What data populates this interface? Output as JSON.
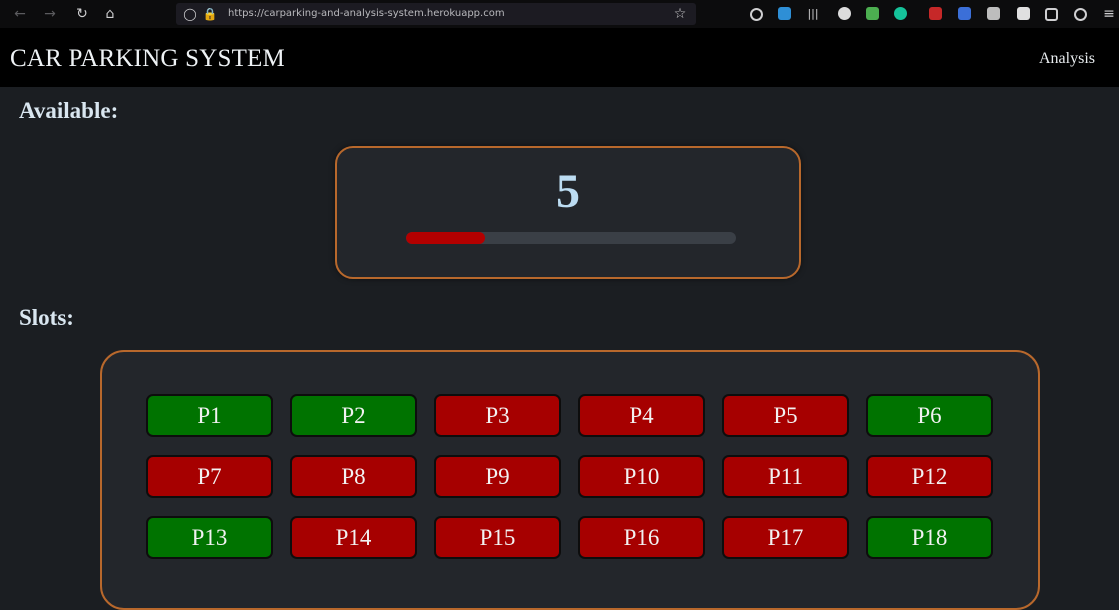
{
  "browser": {
    "url": "https://carparking-and-analysis-system.herokuapp.com"
  },
  "header": {
    "title": "CAR PARKING SYSTEM",
    "analysis_link": "Analysis"
  },
  "available": {
    "heading": "Available:",
    "count": "5",
    "progress_fraction": 0.24
  },
  "slots": {
    "heading": "Slots:",
    "items": [
      {
        "label": "P1",
        "status": "free"
      },
      {
        "label": "P2",
        "status": "free"
      },
      {
        "label": "P3",
        "status": "taken"
      },
      {
        "label": "P4",
        "status": "taken"
      },
      {
        "label": "P5",
        "status": "taken"
      },
      {
        "label": "P6",
        "status": "free"
      },
      {
        "label": "P7",
        "status": "taken"
      },
      {
        "label": "P8",
        "status": "taken"
      },
      {
        "label": "P9",
        "status": "taken"
      },
      {
        "label": "P10",
        "status": "taken"
      },
      {
        "label": "P11",
        "status": "taken"
      },
      {
        "label": "P12",
        "status": "taken"
      },
      {
        "label": "P13",
        "status": "free"
      },
      {
        "label": "P14",
        "status": "taken"
      },
      {
        "label": "P15",
        "status": "taken"
      },
      {
        "label": "P16",
        "status": "taken"
      },
      {
        "label": "P17",
        "status": "taken"
      },
      {
        "label": "P18",
        "status": "free"
      }
    ]
  },
  "colors": {
    "free": "#007300",
    "taken": "#a60000",
    "accent_border": "#b8682c",
    "progress_fill": "#b30000"
  }
}
